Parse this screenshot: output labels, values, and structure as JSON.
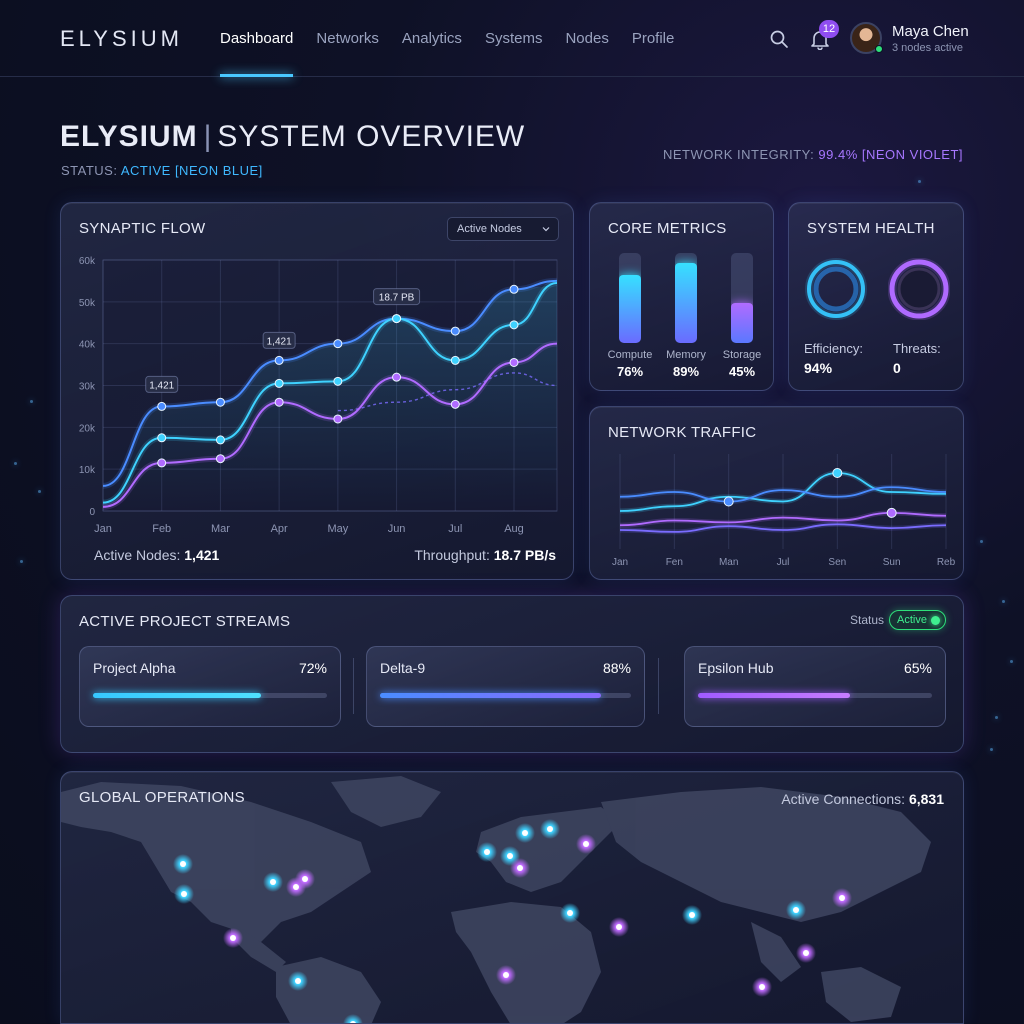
{
  "brand": "ELYSIUM",
  "nav": {
    "items": [
      "Dashboard",
      "Networks",
      "Analytics",
      "Systems",
      "Nodes",
      "Profile"
    ],
    "active": "Dashboard"
  },
  "header_icons": {
    "search": "search-icon",
    "notifications": "bell-icon"
  },
  "notifications_count": "12",
  "user": {
    "name": "Maya Chen",
    "subtitle": "3 nodes active"
  },
  "page": {
    "title_brand": "ELYSIUM",
    "title_separator": "|",
    "title_rest": "SYSTEM OVERVIEW",
    "status_label": "STATUS:",
    "status_value": "ACTIVE [NEON BLUE]",
    "integrity_label": "NETWORK INTEGRITY:",
    "integrity_value": "99.4% [NEON VIOLET]"
  },
  "synaptic_flow": {
    "title": "SYNAPTIC FLOW",
    "dropdown_value": "Active Nodes",
    "footer_left_label": "Active Nodes:",
    "footer_left_value": "1,421",
    "footer_right_label": "Throughput:",
    "footer_right_value": "18.7 PB/s",
    "callouts": [
      "1,421",
      "1,421",
      "18.7 PB"
    ]
  },
  "chart_data": [
    {
      "type": "line",
      "title": "SYNAPTIC FLOW",
      "x": [
        "Jan",
        "Feb",
        "Mar",
        "Apr",
        "May",
        "Jun",
        "Jul",
        "Aug"
      ],
      "y_ticks": [
        "0",
        "10k",
        "20k",
        "30k",
        "40k",
        "50k",
        "60k"
      ],
      "ylim": [
        0,
        60000
      ],
      "grid": true,
      "series": [
        {
          "values": [
            6000,
            25000,
            26000,
            36000,
            40000,
            46000,
            43000,
            53000
          ],
          "color": "#4a8cff"
        },
        {
          "values": [
            2000,
            17500,
            17000,
            30500,
            31000,
            46000,
            36000,
            44500
          ],
          "color": "#3fd2ff"
        },
        {
          "values": [
            1000,
            11500,
            12500,
            26000,
            22000,
            32000,
            25500,
            35500
          ],
          "color": "#b06bff"
        }
      ],
      "dashed_series": {
        "values": [
          null,
          null,
          null,
          null,
          24000,
          26000,
          29000,
          33000
        ],
        "color": "#7a6cff"
      }
    },
    {
      "type": "line",
      "title": "NETWORK TRAFFIC",
      "x": [
        "Jan",
        "Fen",
        "Man",
        "Jul",
        "Sen",
        "Sun",
        "Reb"
      ],
      "grid": true,
      "series": [
        {
          "values": [
            0.4,
            0.45,
            0.55,
            0.5,
            0.8,
            0.6,
            0.58
          ],
          "color": "#3fd2ff"
        },
        {
          "values": [
            0.55,
            0.6,
            0.5,
            0.62,
            0.55,
            0.65,
            0.6
          ],
          "color": "#4a8cff"
        },
        {
          "values": [
            0.25,
            0.3,
            0.28,
            0.33,
            0.3,
            0.38,
            0.35
          ],
          "color": "#b06bff"
        },
        {
          "values": [
            0.2,
            0.18,
            0.24,
            0.2,
            0.26,
            0.22,
            0.25
          ],
          "color": "#7a6cff"
        }
      ]
    },
    {
      "type": "bar",
      "title": "CORE METRICS",
      "categories": [
        "Compute",
        "Memory",
        "Storage"
      ],
      "values": [
        76,
        89,
        45
      ],
      "ylim": [
        0,
        100
      ]
    }
  ],
  "core_metrics": {
    "title": "CORE METRICS",
    "items": [
      {
        "label": "Compute",
        "value": "76%",
        "fill": 0.76,
        "color_top": "#36e0ff",
        "color_bottom": "#6a6bff"
      },
      {
        "label": "Memory",
        "value": "89%",
        "fill": 0.89,
        "color_top": "#36e0ff",
        "color_bottom": "#6a6bff"
      },
      {
        "label": "Storage",
        "value": "45%",
        "fill": 0.45,
        "color_top": "#b06bff",
        "color_bottom": "#5a78ff"
      }
    ]
  },
  "system_health": {
    "title": "SYSTEM HEALTH",
    "efficiency_label": "Efficiency:",
    "efficiency_value": "94%",
    "threats_label": "Threats:",
    "threats_value": "0",
    "efficiency_color": "#36c8ff",
    "threats_color": "#b06bff"
  },
  "network_traffic": {
    "title": "NETWORK TRAFFIC",
    "x_labels": [
      "Jan",
      "Fen",
      "Man",
      "Jul",
      "Sen",
      "Sun",
      "Reb"
    ]
  },
  "streams": {
    "title": "ACTIVE PROJECT STREAMS",
    "status_label": "Status",
    "status_value": "Active",
    "items": [
      {
        "name": "Project Alpha",
        "percent": "72%",
        "fill": 0.72,
        "color_a": "#36c8ff",
        "color_b": "#4fe0ff"
      },
      {
        "name": "Delta-9",
        "percent": "88%",
        "fill": 0.88,
        "color_a": "#4a8cff",
        "color_b": "#8a6bff"
      },
      {
        "name": "Epsilon Hub",
        "percent": "65%",
        "fill": 0.65,
        "color_a": "#a05bff",
        "color_b": "#c77dff"
      }
    ]
  },
  "global": {
    "title": "GLOBAL OPERATIONS",
    "connections_label": "Active Connections:",
    "connections_value": "6,831"
  },
  "colors": {
    "accent_blue": "#3fb8ff",
    "accent_violet": "#a777ff",
    "active_green": "#2ee07a"
  }
}
